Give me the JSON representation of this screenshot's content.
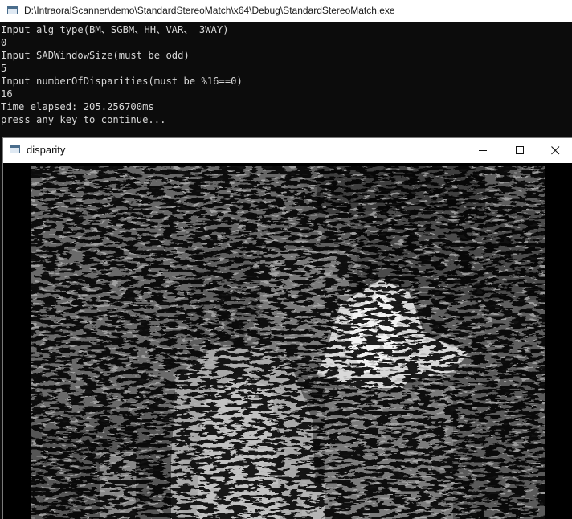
{
  "console_window": {
    "title": "D:\\IntraoralScanner\\demo\\StandardStereoMatch\\x64\\Debug\\StandardStereoMatch.exe",
    "lines": [
      "Input alg type(BM、SGBM、HH、VAR、 3WAY)",
      "0",
      "Input SADWindowSize(must be odd)",
      "5",
      "Input numberOfDisparities(must be %16==0)",
      "16",
      "Time elapsed: 205.256700ms",
      "press any key to continue..."
    ]
  },
  "disparity_window": {
    "title": "disparity",
    "controls": {
      "minimize_icon": "minimize-icon",
      "maximize_icon": "maximize-icon",
      "close_icon": "close-icon"
    }
  },
  "colors": {
    "console_background": "#0c0c0c",
    "console_text": "#d8d8d8",
    "titlebar_background": "#ffffff"
  }
}
